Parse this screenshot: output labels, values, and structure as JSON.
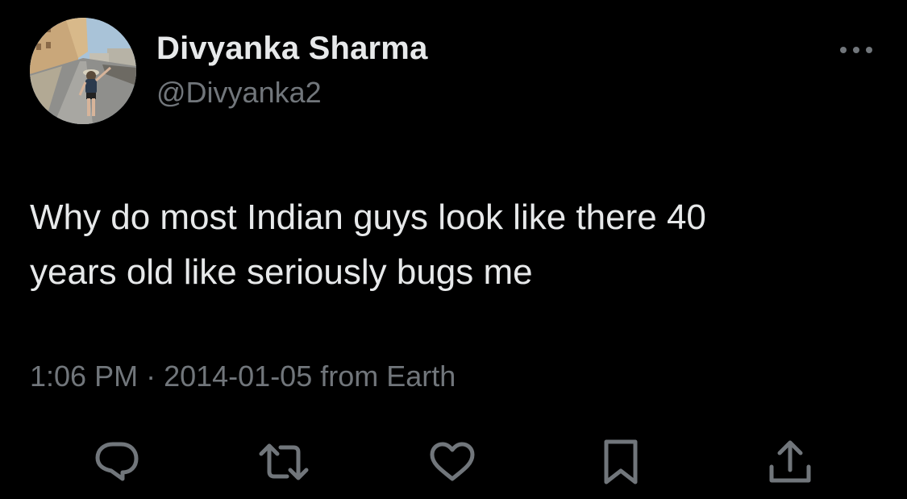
{
  "tweet": {
    "display_name": "Divyanka Sharma",
    "handle": "@Divyanka2",
    "avatar_icon": "avatar-photo",
    "text_line1": "Why do most Indian guys look like there 40",
    "text_line2": "years old like seriously bugs me",
    "time": "1:06 PM",
    "separator": "·",
    "date": "2014-01-05",
    "source": "from Earth"
  },
  "icons": {
    "more": "more-horizontal-icon",
    "reply": "reply-icon",
    "retweet": "retweet-icon",
    "like": "heart-icon",
    "bookmark": "bookmark-icon",
    "share": "share-icon"
  },
  "colors": {
    "background": "#000000",
    "primary_text": "#e7e9ea",
    "secondary_text": "#71767b"
  }
}
